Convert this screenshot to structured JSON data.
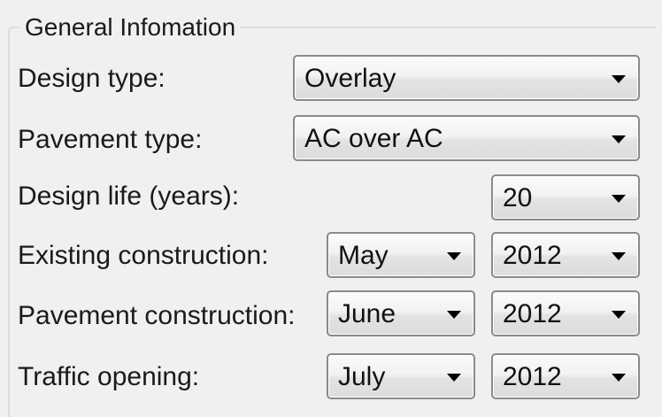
{
  "group": {
    "title": "General Infomation"
  },
  "fields": {
    "design_type": {
      "label": "Design type:",
      "value": "Overlay"
    },
    "pavement_type": {
      "label": "Pavement type:",
      "value": "AC over AC"
    },
    "design_life": {
      "label": "Design life (years):",
      "value": "20"
    },
    "existing_construction": {
      "label": "Existing construction:",
      "month": "May",
      "year": "2012"
    },
    "pavement_construction": {
      "label": "Pavement construction:",
      "month": "June",
      "year": "2012"
    },
    "traffic_opening": {
      "label": "Traffic opening:",
      "month": "July",
      "year": "2012"
    }
  },
  "icons": {
    "dropdown": "chevron-down-icon"
  }
}
